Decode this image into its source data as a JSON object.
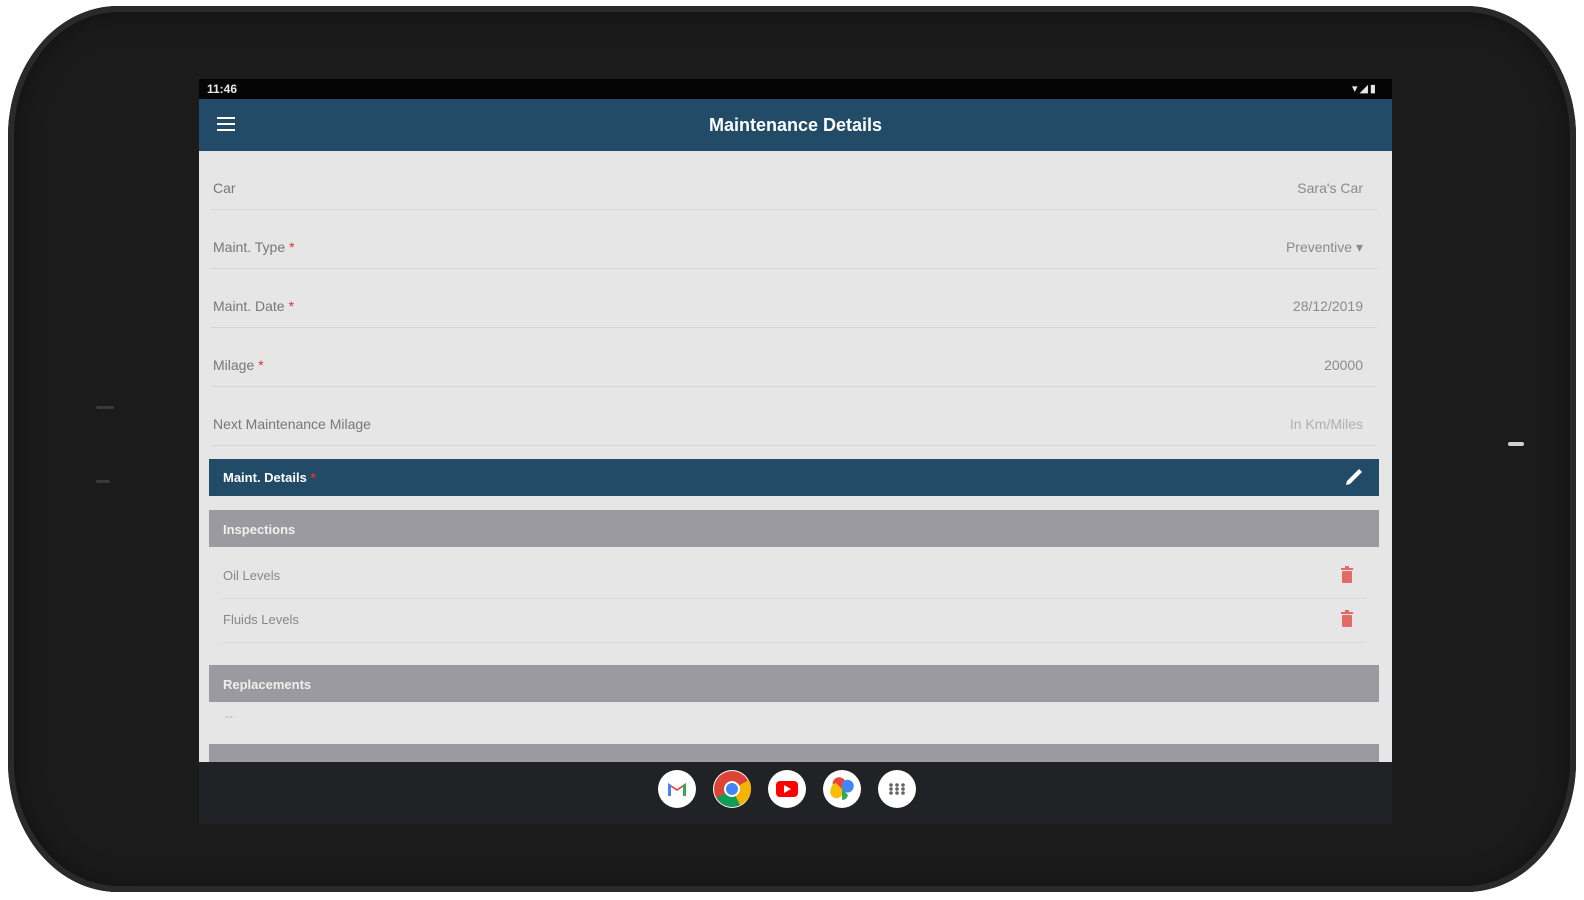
{
  "status_bar": {
    "time": "11:46",
    "icons": "▾◢▮"
  },
  "app_bar": {
    "title": "Maintenance Details"
  },
  "form": {
    "fields": [
      {
        "label": "Car",
        "value": "Sara's Car",
        "required": false,
        "placeholder": false
      },
      {
        "label": "Maint. Type",
        "value": "Preventive ▾",
        "required": true,
        "placeholder": false
      },
      {
        "label": "Maint. Date",
        "value": "28/12/2019",
        "required": true,
        "placeholder": false
      },
      {
        "label": "Milage",
        "value": "20000",
        "required": true,
        "placeholder": false
      },
      {
        "label": "Next Maintenance Milage",
        "value": "In Km/Miles",
        "required": false,
        "placeholder": true
      }
    ],
    "required_mark": "*"
  },
  "sections": {
    "details": {
      "label": "Maint. Details",
      "required_mark": "*"
    },
    "inspections": {
      "label": "Inspections",
      "items": [
        "Oil Levels",
        "Fluids Levels"
      ]
    },
    "replacements": {
      "label": "Replacements",
      "empty": "--"
    }
  },
  "colors": {
    "app_bar": "#224b68",
    "section_gray": "#9a9aa0",
    "required": "#dd3333",
    "trash": "#e46a6a"
  },
  "dock": [
    "gmail-icon",
    "chrome-icon",
    "youtube-icon",
    "photos-icon",
    "app-drawer-icon"
  ]
}
